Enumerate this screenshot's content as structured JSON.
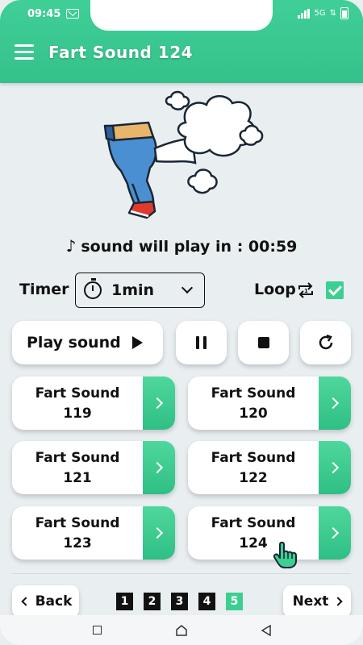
{
  "status_bar": {
    "time": "09:45",
    "network": "5G"
  },
  "header": {
    "title": "Fart Sound 124"
  },
  "countdown": {
    "label": "sound will play in : 00:59"
  },
  "timer": {
    "label": "Timer",
    "value": "1min"
  },
  "loop": {
    "label": "Loop",
    "checked": true
  },
  "controls": {
    "play_label": "Play sound"
  },
  "sounds": [
    {
      "line1": "Fart Sound",
      "line2": "119"
    },
    {
      "line1": "Fart Sound",
      "line2": "120"
    },
    {
      "line1": "Fart Sound",
      "line2": "121"
    },
    {
      "line1": "Fart Sound",
      "line2": "122"
    },
    {
      "line1": "Fart Sound",
      "line2": "123"
    },
    {
      "line1": "Fart Sound",
      "line2": "124"
    }
  ],
  "pagination": {
    "back_label": "Back",
    "next_label": "Next",
    "pages": [
      "1",
      "2",
      "3",
      "4",
      "5"
    ],
    "active_page": "5"
  },
  "colors": {
    "accent": "#3dcf92",
    "background": "#e9eef1",
    "text": "#111111"
  },
  "icons": [
    "menu-icon",
    "music-note-icon",
    "stopwatch-icon",
    "chevron-down-icon",
    "loop-icon",
    "checkbox-icon",
    "play-icon",
    "pause-icon",
    "stop-icon",
    "refresh-icon",
    "chevron-right-icon",
    "hand-pointer-icon",
    "chevron-left-icon"
  ]
}
